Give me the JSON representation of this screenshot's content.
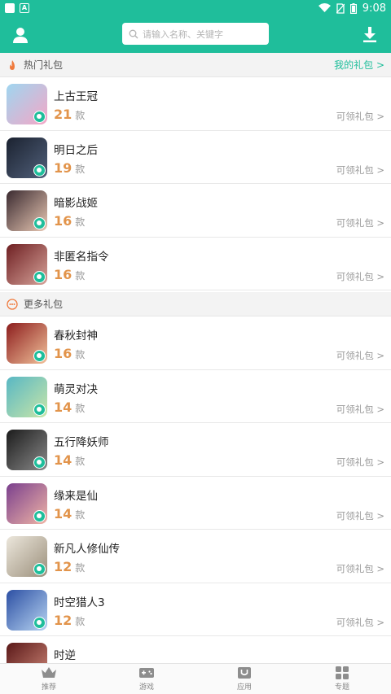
{
  "status_bar": {
    "time": "9:08"
  },
  "search": {
    "placeholder": "请输入名称、关键字"
  },
  "hot_section": {
    "title": "热门礼包",
    "link": "我的礼包 >"
  },
  "hot_list": [
    {
      "name": "上古王冠",
      "count": "21",
      "unit": "款",
      "claim": "可领礼包 >",
      "colors": [
        "#9fd6f0",
        "#f4a6c6"
      ]
    },
    {
      "name": "明日之后",
      "count": "19",
      "unit": "款",
      "claim": "可领礼包 >",
      "colors": [
        "#1b2230",
        "#51607a"
      ]
    },
    {
      "name": "暗影战姬",
      "count": "16",
      "unit": "款",
      "claim": "可领礼包 >",
      "colors": [
        "#3a2a30",
        "#e9c8b4"
      ]
    },
    {
      "name": "非匿名指令",
      "count": "16",
      "unit": "款",
      "claim": "可领礼包 >",
      "colors": [
        "#6e1f22",
        "#d7a39a"
      ]
    }
  ],
  "more_section": {
    "title": "更多礼包"
  },
  "more_list": [
    {
      "name": "春秋封神",
      "count": "16",
      "unit": "款",
      "claim": "可领礼包 >",
      "colors": [
        "#8c1d1d",
        "#f2c29b"
      ]
    },
    {
      "name": "萌灵对决",
      "count": "14",
      "unit": "款",
      "claim": "可领礼包 >",
      "colors": [
        "#58b7c4",
        "#c9e6a8"
      ]
    },
    {
      "name": "五行降妖师",
      "count": "14",
      "unit": "款",
      "claim": "可领礼包 >",
      "colors": [
        "#1b1b1b",
        "#8a8a8a"
      ]
    },
    {
      "name": "缘来是仙",
      "count": "14",
      "unit": "款",
      "claim": "可领礼包 >",
      "colors": [
        "#7a3f8d",
        "#f0b5a6"
      ]
    },
    {
      "name": "新凡人修仙传",
      "count": "12",
      "unit": "款",
      "claim": "可领礼包 >",
      "colors": [
        "#ece7dc",
        "#9b8f7b"
      ]
    },
    {
      "name": "时空猎人3",
      "count": "12",
      "unit": "款",
      "claim": "可领礼包 >",
      "colors": [
        "#2c4fa3",
        "#b7d4f2"
      ]
    },
    {
      "name": "时逆",
      "count": "",
      "unit": "",
      "claim": "",
      "colors": [
        "#5a1818",
        "#d18a7a"
      ]
    }
  ],
  "tabs": [
    {
      "label": "推荐",
      "icon": "crown-icon"
    },
    {
      "label": "游戏",
      "icon": "gamepad-icon"
    },
    {
      "label": "应用",
      "icon": "app-box-icon"
    },
    {
      "label": "专题",
      "icon": "grid-icon"
    }
  ],
  "theme": {
    "accent": "#1fbe9b",
    "count_color": "#e2944b"
  }
}
